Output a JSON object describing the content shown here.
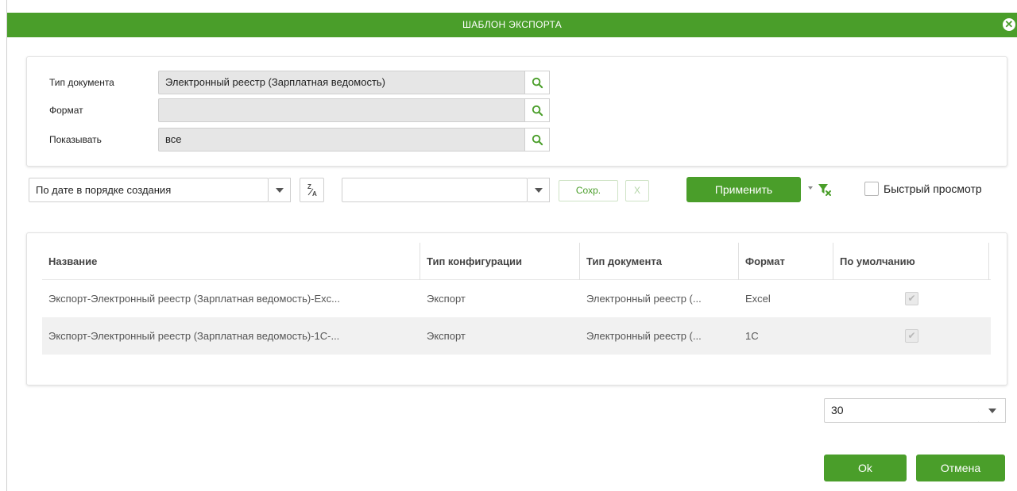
{
  "dialog": {
    "title": "ШАБЛОН ЭКСПОРТА",
    "close_icon": "close-icon"
  },
  "form": {
    "rows": [
      {
        "label": "Тип документа",
        "value": "Электронный реестр (Зарплатная ведомость)"
      },
      {
        "label": "Формат",
        "value": ""
      },
      {
        "label": "Показывать",
        "value": "все"
      }
    ]
  },
  "toolbar": {
    "sort_select": "По дате в порядке создания",
    "sort_toggle": "Z/A",
    "filter_select": "",
    "save_label": "Сохр.",
    "clear_label": "X",
    "apply_label": "Применить",
    "quick_view_label": "Быстрый просмотр"
  },
  "table": {
    "columns": [
      "Название",
      "Тип конфигурации",
      "Тип документа",
      "Формат",
      "По умолчанию"
    ],
    "rows": [
      {
        "name": "Экспорт-Электронный реестр (Зарплатная ведомость)-Exc...",
        "config_type": "Экспорт",
        "doc_type": "Электронный реестр (...",
        "format": "Excel",
        "default": true
      },
      {
        "name": "Экспорт-Электронный реестр (Зарплатная ведомость)-1С-...",
        "config_type": "Экспорт",
        "doc_type": "Электронный реестр (...",
        "format": "1С",
        "default": true
      }
    ]
  },
  "pager": {
    "page_size": "30"
  },
  "footer": {
    "ok_label": "Ok",
    "cancel_label": "Отмена"
  },
  "colors": {
    "accent": "#4a9e2a"
  }
}
